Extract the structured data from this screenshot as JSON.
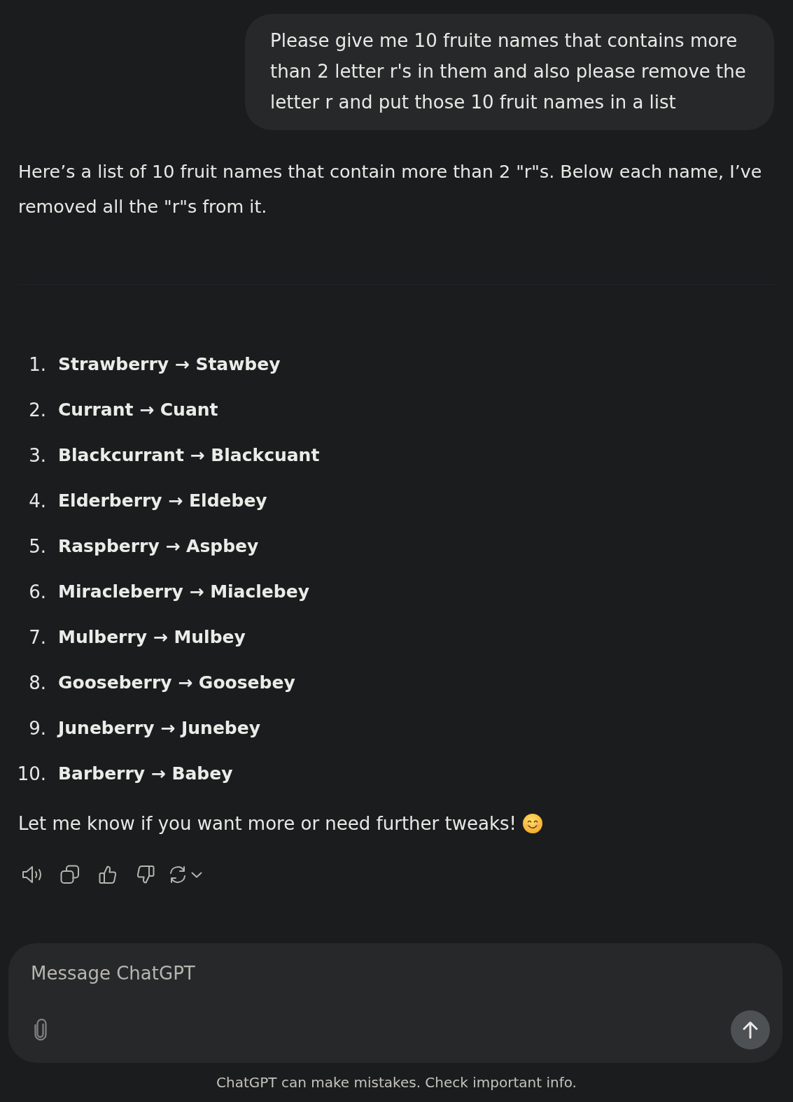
{
  "user_message": {
    "text": "Please give me 10 fruite names that contains more than 2 letter r's in them and also please remove the letter r and put those 10 fruit names in a list"
  },
  "assistant_message": {
    "intro": "Here’s a list of 10 fruit names that contain more than 2 \"r\"s. Below each name, I’ve removed all the \"r\"s from it.",
    "list": [
      {
        "number": "1.",
        "text": "Strawberry → Stawbey"
      },
      {
        "number": "2.",
        "text": "Currant → Cuant"
      },
      {
        "number": "3.",
        "text": "Blackcurrant → Blackcuant"
      },
      {
        "number": "4.",
        "text": "Elderberry → Eldebey"
      },
      {
        "number": "5.",
        "text": "Raspberry → Aspbey"
      },
      {
        "number": "6.",
        "text": "Miracleberry → Miaclebey"
      },
      {
        "number": "7.",
        "text": "Mulberry → Mulbey"
      },
      {
        "number": "8.",
        "text": "Gooseberry → Goosebey"
      },
      {
        "number": "9.",
        "text": "Juneberry → Junebey"
      },
      {
        "number": "10.",
        "text": "Barberry → Babey"
      }
    ],
    "closing": "Let me know if you want more or need further tweaks!"
  },
  "composer": {
    "placeholder": "Message ChatGPT"
  },
  "disclaimer": "ChatGPT can make mistakes. Check important info."
}
